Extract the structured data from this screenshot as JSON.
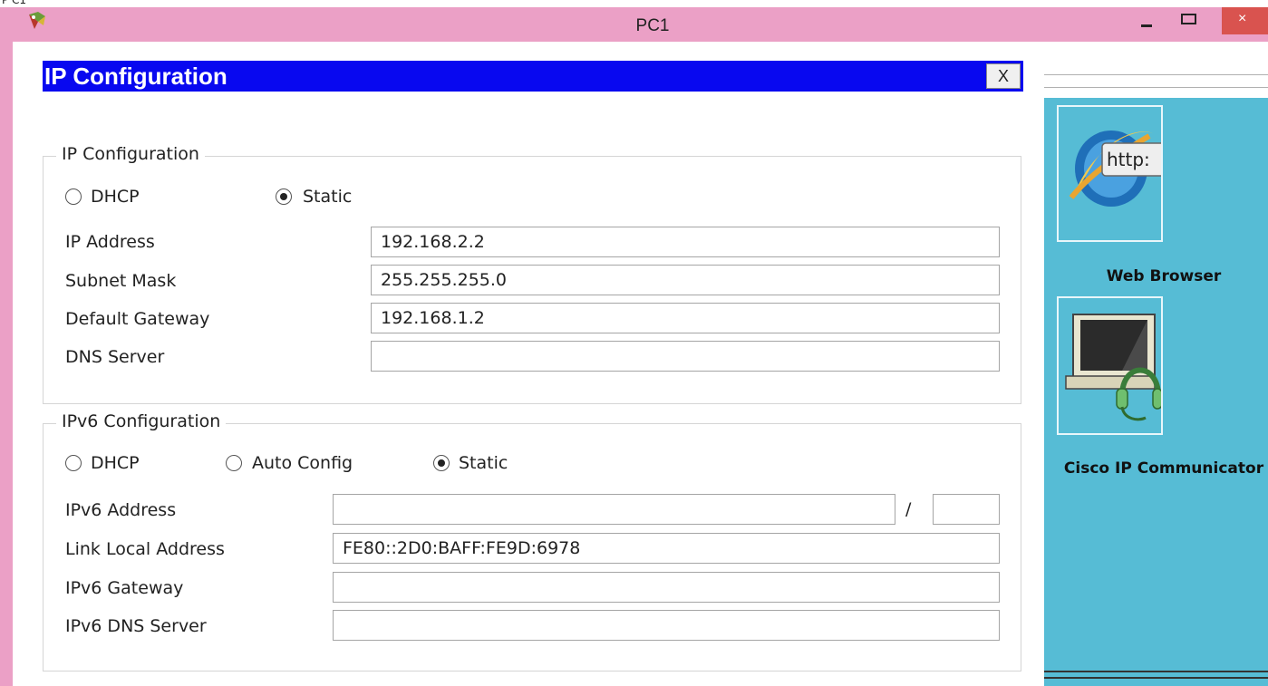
{
  "window": {
    "title": "PC1",
    "close_glyph": "×"
  },
  "dialog": {
    "title": "IP Configuration",
    "close_glyph": "X"
  },
  "ipv4": {
    "legend": "IP Configuration",
    "mode_dhcp": "DHCP",
    "mode_static": "Static",
    "selected_mode": "Static",
    "ip_address_label": "IP Address",
    "ip_address": "192.168.2.2",
    "subnet_mask_label": "Subnet Mask",
    "subnet_mask": "255.255.255.0",
    "gateway_label": "Default Gateway",
    "gateway": "192.168.1.2",
    "dns_label": "DNS Server",
    "dns": ""
  },
  "ipv6": {
    "legend": "IPv6 Configuration",
    "mode_dhcp": "DHCP",
    "mode_auto": "Auto Config",
    "mode_static": "Static",
    "selected_mode": "Static",
    "address_label": "IPv6 Address",
    "address": "",
    "prefix_separator": "/",
    "prefix": "",
    "link_local_label": "Link Local Address",
    "link_local": "FE80::2D0:BAFF:FE9D:6978",
    "gateway_label": "IPv6 Gateway",
    "gateway": "",
    "dns_label": "IPv6 DNS Server",
    "dns": ""
  },
  "desktop_apps": [
    {
      "label": "Web Browser",
      "icon": "web-browser-icon",
      "badge": "http:"
    },
    {
      "label": "Cisco IP Communicator",
      "icon": "cisco-ip-communicator-icon"
    }
  ],
  "colors": {
    "window_frame": "#eba0c6",
    "dialog_title_bar": "#0808f0",
    "desktop_panel": "#56bcd5",
    "close_button": "#d9534f"
  }
}
